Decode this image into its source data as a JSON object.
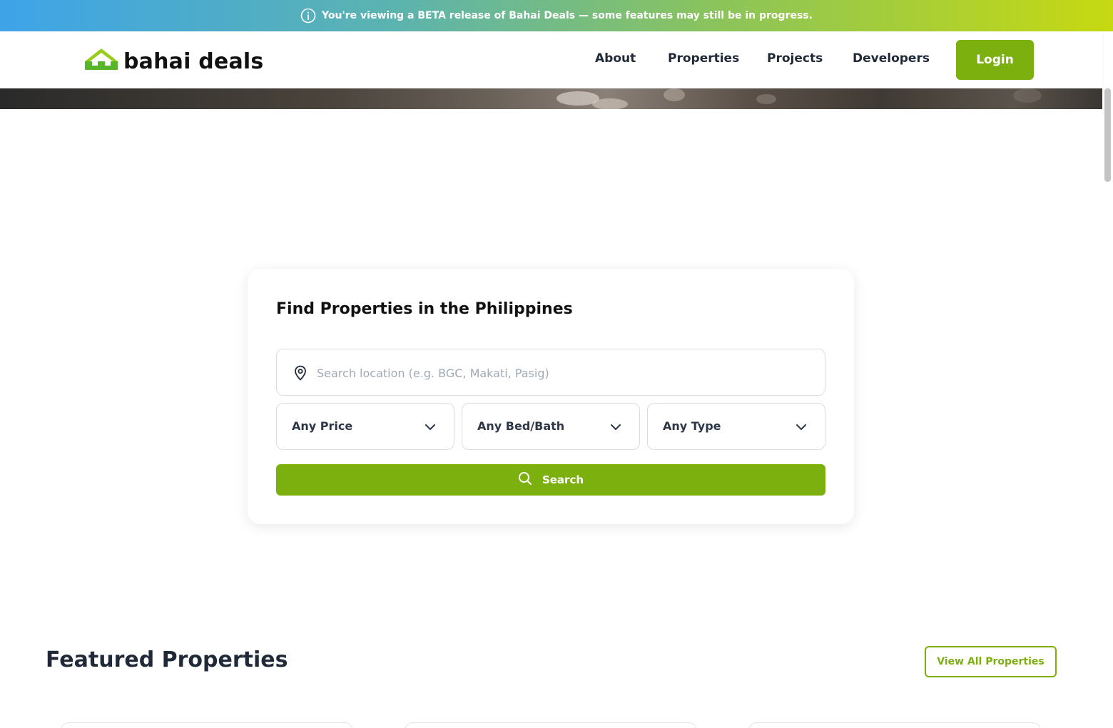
{
  "beta_banner": {
    "icon": "info-icon",
    "text": "You're viewing a BETA release of Bahai Deals — some features may still be in progress."
  },
  "brand": {
    "logo_text": "bahai deals",
    "logo_icon": "house-logo-icon",
    "primary_color": "#7cb00f"
  },
  "nav": {
    "items": [
      {
        "label": "About"
      },
      {
        "label": "Properties"
      },
      {
        "label": "Projects"
      },
      {
        "label": "Developers"
      }
    ],
    "login_label": "Login"
  },
  "search": {
    "title": "Find Properties in the Philippines",
    "location_placeholder": "Search location (e.g. BGC, Makati, Pasig)",
    "location_icon": "map-pin-icon",
    "filters": [
      {
        "label": "Any Price"
      },
      {
        "label": "Any Bed/Bath"
      },
      {
        "label": "Any Type"
      }
    ],
    "button_label": "Search",
    "button_icon": "search-icon"
  },
  "featured": {
    "title": "Featured Properties",
    "view_all_label": "View All Properties"
  }
}
